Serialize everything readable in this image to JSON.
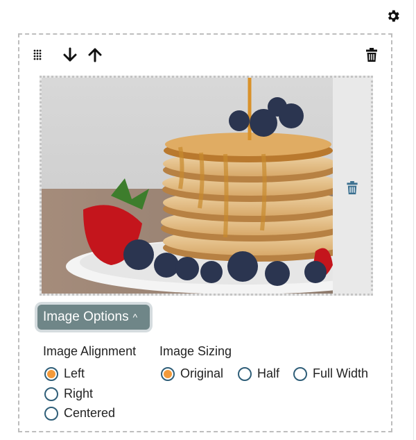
{
  "toolbar": {
    "icons": [
      "drag-handle-icon",
      "arrow-down-icon",
      "arrow-up-icon",
      "trash-icon"
    ]
  },
  "header": {
    "icon": "gear-icon"
  },
  "image": {
    "alt": "Stack of pancakes with syrup, blueberries and strawberries"
  },
  "options_button": {
    "label": "Image Options",
    "chevron": "^"
  },
  "alignment": {
    "title": "Image Alignment",
    "options": [
      "Left",
      "Right",
      "Centered"
    ],
    "selected": "Left"
  },
  "sizing": {
    "title": "Image Sizing",
    "options": [
      "Original",
      "Half",
      "Full Width"
    ],
    "selected": "Original"
  },
  "colors": {
    "accent": "#f39a3a",
    "radio_border": "#2f5e78",
    "button_bg": "#6f8688",
    "trash_blue": "#3a6f8f"
  }
}
